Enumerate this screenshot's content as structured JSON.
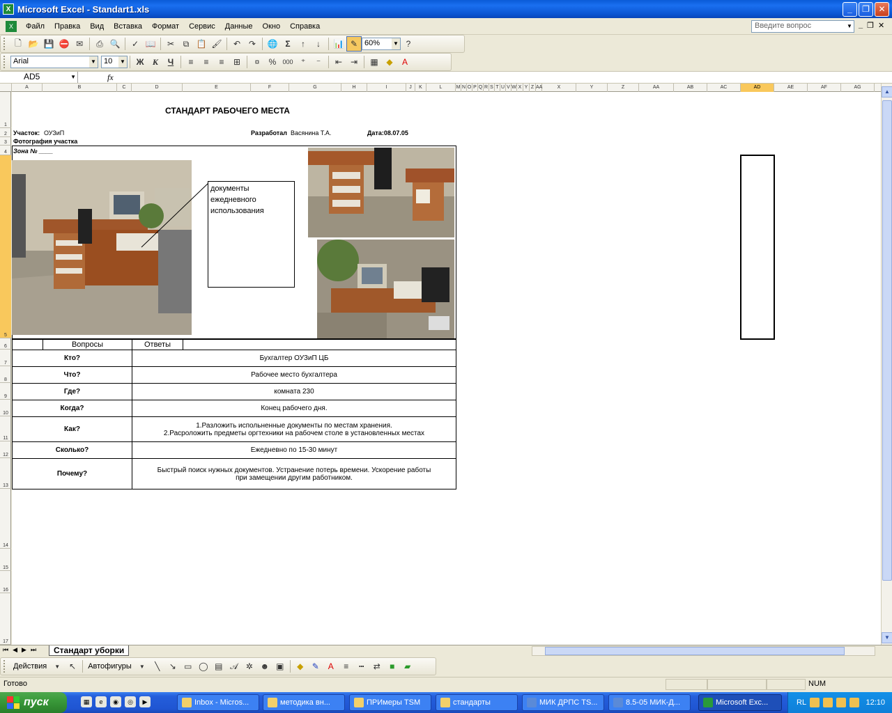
{
  "window": {
    "title": "Microsoft Excel - Standart1.xls"
  },
  "menu": [
    "Файл",
    "Правка",
    "Вид",
    "Вставка",
    "Формат",
    "Сервис",
    "Данные",
    "Окно",
    "Справка"
  ],
  "help": {
    "placeholder": "Введите вопрос"
  },
  "toolbar": {
    "zoom": "60%",
    "font": "Arial",
    "size": "10",
    "bold": "Ж",
    "italic": "К",
    "underline": "Ч",
    "percent": "%",
    "thousands": "000",
    "sigma": "Σ"
  },
  "formula_bar": {
    "name_box": "AD5",
    "fx": "fx",
    "value": ""
  },
  "columns": [
    "A",
    "B",
    "C",
    "D",
    "E",
    "F",
    "G",
    "H",
    "I",
    "J",
    "K",
    "L",
    "M",
    "N",
    "O",
    "P",
    "Q",
    "R",
    "S",
    "T",
    "U",
    "V",
    "W",
    "X",
    "Y",
    "Z",
    "AA",
    "AB",
    "AC",
    "AD",
    "AE",
    "AF",
    "AG"
  ],
  "selected_column": "AD",
  "rows": [
    "1",
    "2",
    "3",
    "4",
    "5",
    "6",
    "7",
    "8",
    "9",
    "10",
    "11",
    "12",
    "13",
    "14",
    "15",
    "16",
    "17"
  ],
  "selected_row": "5",
  "sheet": {
    "title": "СТАНДАРТ РАБОЧЕГО МЕСТА",
    "uchastok_label": "Участок:",
    "uchastok_value": "ОУЗиП",
    "razrabotal_label": "Разработал",
    "razrabotal_value": "Васянина Т.А.",
    "date": "Дата:08.07.05",
    "photo_label": "Фотография участка",
    "zona": "Зона № ____",
    "callout": "документы ежедневного использования",
    "table_header": {
      "questions": "Вопросы",
      "answers": "Ответы"
    },
    "table_rows": [
      {
        "q": "Кто?",
        "a": [
          "Бухгалтер ОУЗиП ЦБ"
        ]
      },
      {
        "q": "Что?",
        "a": [
          "Рабочее место бухгалтера"
        ]
      },
      {
        "q": "Где?",
        "a": [
          "комната 230"
        ]
      },
      {
        "q": "Когда?",
        "a": [
          "Конец рабочего дня."
        ]
      },
      {
        "q": "Как?",
        "a": [
          "1.Разложить испольненные документы по местам хранения.",
          "2.Расроложить предметы оргтехники на рабочем столе в установленных местах"
        ]
      },
      {
        "q": "Сколько?",
        "a": [
          "Ежедневно по 15-30 минут"
        ]
      },
      {
        "q": "Почему?",
        "a": [
          "Быстрый поиск нужных документов. Устранение потерь времени. Ускорение работы",
          "при замещении другим работником."
        ]
      }
    ]
  },
  "sheet_tab": "Стандарт уборки",
  "drawing": {
    "actions": "Действия",
    "autoshapes": "Автофигуры"
  },
  "status": {
    "ready": "Готово",
    "num": "NUM"
  },
  "taskbar": {
    "start": "пуск",
    "tasks": [
      "Inbox - Micros...",
      "методика вн...",
      "ПРИмеры TSM",
      "стандарты",
      "МИК ДРПС TS...",
      "8.5-05 МИК-Д...",
      "Microsoft Exc..."
    ],
    "lang": "RL",
    "clock": "12:10"
  },
  "colors": {
    "accent": "#0a54d0",
    "selection": "#f9c85c",
    "taskbar": "#245edb"
  }
}
